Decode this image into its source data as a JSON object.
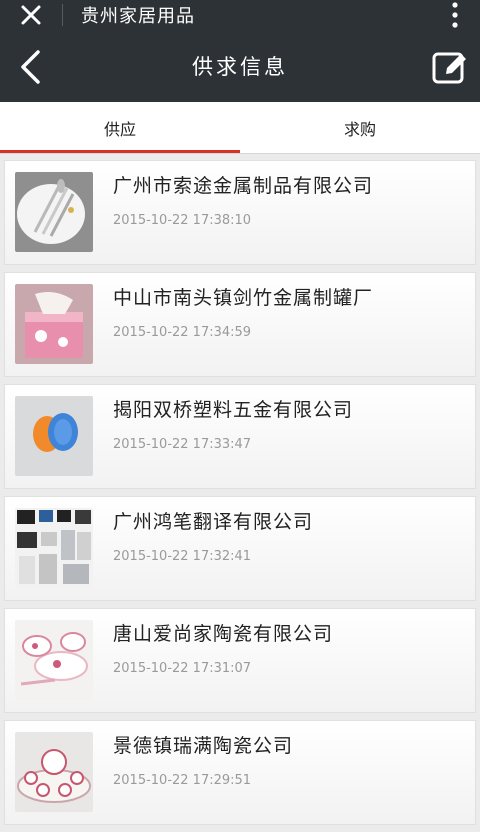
{
  "topbar": {
    "app_title": "贵州家居用品"
  },
  "navbar": {
    "title": "供求信息"
  },
  "tabs": [
    {
      "label": "供应",
      "active": true
    },
    {
      "label": "求购",
      "active": false
    }
  ],
  "colors": {
    "bar": "#2d3236",
    "tab_indicator": "#d5332a"
  },
  "list": [
    {
      "company": "广州市索途金属制品有限公司",
      "time": "2015-10-22 17:38:10",
      "thumb": "cutlery"
    },
    {
      "company": "中山市南头镇剑竹金属制罐厂",
      "time": "2015-10-22 17:34:59",
      "thumb": "tin-box"
    },
    {
      "company": "揭阳双桥塑料五金有限公司",
      "time": "2015-10-22 17:33:47",
      "thumb": "plastic-cups"
    },
    {
      "company": "广州鸿笔翻译有限公司",
      "time": "2015-10-22 17:32:41",
      "thumb": "electronics"
    },
    {
      "company": "唐山爱尚家陶瓷有限公司",
      "time": "2015-10-22 17:31:07",
      "thumb": "ceramic-set"
    },
    {
      "company": "景德镇瑞满陶瓷公司",
      "time": "2015-10-22 17:29:51",
      "thumb": "tea-set"
    }
  ]
}
